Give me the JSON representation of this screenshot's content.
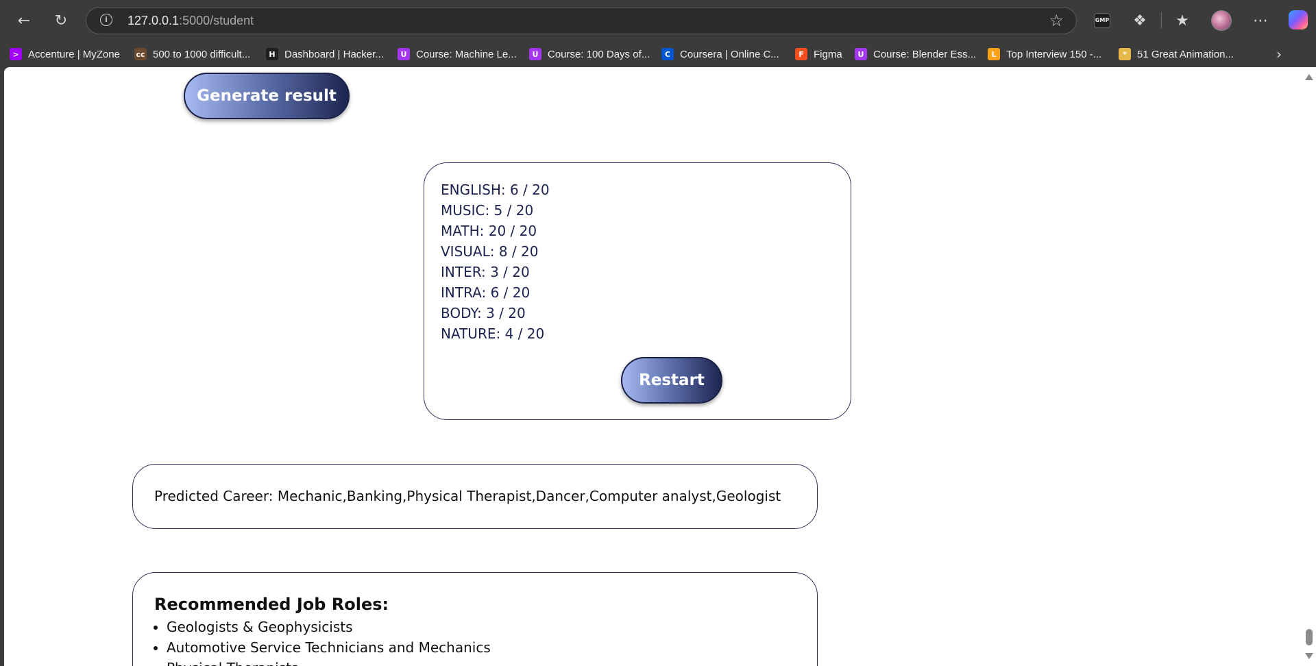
{
  "browser": {
    "url_host": "127.0.0.1",
    "url_path": ":5000/student",
    "extension_badge": "GMP",
    "bookmarks": [
      {
        "label": "Accenture | MyZone",
        "icon": "accenture-icon",
        "glyph": ">",
        "color": "#a100ff"
      },
      {
        "label": "500 to 1000 difficult...",
        "icon": "codechef-icon",
        "glyph": "cc",
        "color": "#6b4a2f"
      },
      {
        "label": "Dashboard | Hacker...",
        "icon": "hackerrank-icon",
        "glyph": "H",
        "color": "#1e1e1e"
      },
      {
        "label": "Course: Machine Le...",
        "icon": "udemy-icon",
        "glyph": "U",
        "color": "#a435f0"
      },
      {
        "label": "Course: 100 Days of...",
        "icon": "udemy-icon",
        "glyph": "U",
        "color": "#a435f0"
      },
      {
        "label": "Coursera | Online C...",
        "icon": "coursera-icon",
        "glyph": "C",
        "color": "#0056d2"
      },
      {
        "label": "Figma",
        "icon": "figma-icon",
        "glyph": "F",
        "color": "#f24e1e"
      },
      {
        "label": "Course: Blender Ess...",
        "icon": "udemy-icon",
        "glyph": "U",
        "color": "#a435f0"
      },
      {
        "label": "Top Interview 150 -...",
        "icon": "leetcode-icon",
        "glyph": "L",
        "color": "#ffa116"
      },
      {
        "label": "51 Great Animation...",
        "icon": "island-icon",
        "glyph": "*",
        "color": "#e6b84a"
      }
    ]
  },
  "page": {
    "generate_label": "Generate result",
    "restart_label": "Restart",
    "scores": [
      "ENGLISH: 6 / 20",
      "MUSIC: 5 / 20",
      "MATH: 20 / 20",
      "VISUAL: 8 / 20",
      "INTER: 3 / 20",
      "INTRA: 6 / 20",
      "BODY: 3 / 20",
      "NATURE: 4 / 20"
    ],
    "predicted_career": "Predicted Career: Mechanic,Banking,Physical Therapist,Dancer,Computer analyst,Geologist",
    "jobs_title": "Recommended Job Roles:",
    "jobs": [
      "Geologists & Geophysicists",
      "Automotive Service Technicians and Mechanics",
      "Physical Therapists"
    ]
  }
}
